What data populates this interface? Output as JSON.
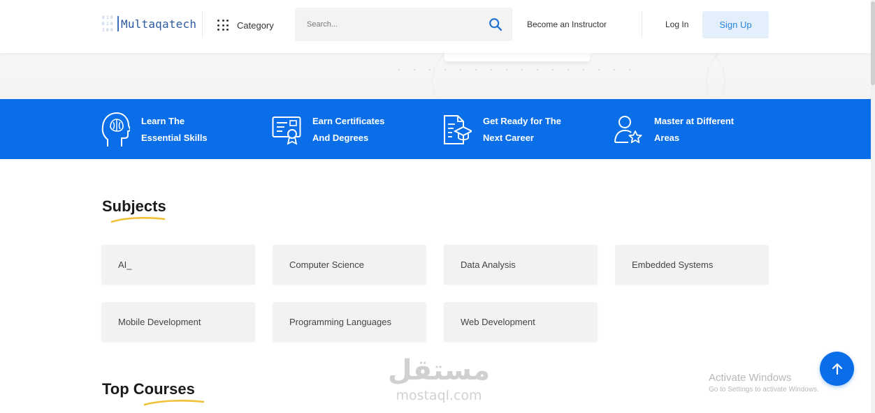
{
  "header": {
    "logo_text": "Multaqatech",
    "logo_bits": [
      "0",
      "1",
      "0",
      "0",
      "1",
      "0",
      "1",
      "0",
      "0"
    ],
    "category_label": "Category",
    "search_placeholder": "Search...",
    "instructor_label": "Become an Instructor",
    "login_label": "Log In",
    "signup_label": "Sign Up"
  },
  "features": [
    {
      "line1": "Learn The",
      "line2": "Essential Skills",
      "icon": "brain-head-icon"
    },
    {
      "line1": "Earn Certificates",
      "line2": "And Degrees",
      "icon": "certificate-icon"
    },
    {
      "line1": "Get Ready for The",
      "line2": "Next Career",
      "icon": "document-graduation-icon"
    },
    {
      "line1": "Master at Different",
      "line2": "Areas",
      "icon": "user-star-icon"
    }
  ],
  "subjects": {
    "title": "Subjects",
    "items": [
      "AI_",
      "Computer Science",
      "Data Analysis",
      "Embedded Systems",
      "Mobile Development",
      "Programming Languages",
      "Web Development"
    ]
  },
  "top_courses": {
    "title": "Top Courses"
  },
  "watermark": {
    "arabic": "مستقل",
    "latin": "mostaql.com"
  },
  "os_notice": {
    "line1": "Activate Windows",
    "line2": "Go to Settings to activate Windows."
  },
  "colors": {
    "primary": "#0a6ee8",
    "signup_bg": "#e3f0fc",
    "signup_text": "#2a86de",
    "accent_underline": "#f2c037",
    "card_bg": "#f1f2f4"
  }
}
